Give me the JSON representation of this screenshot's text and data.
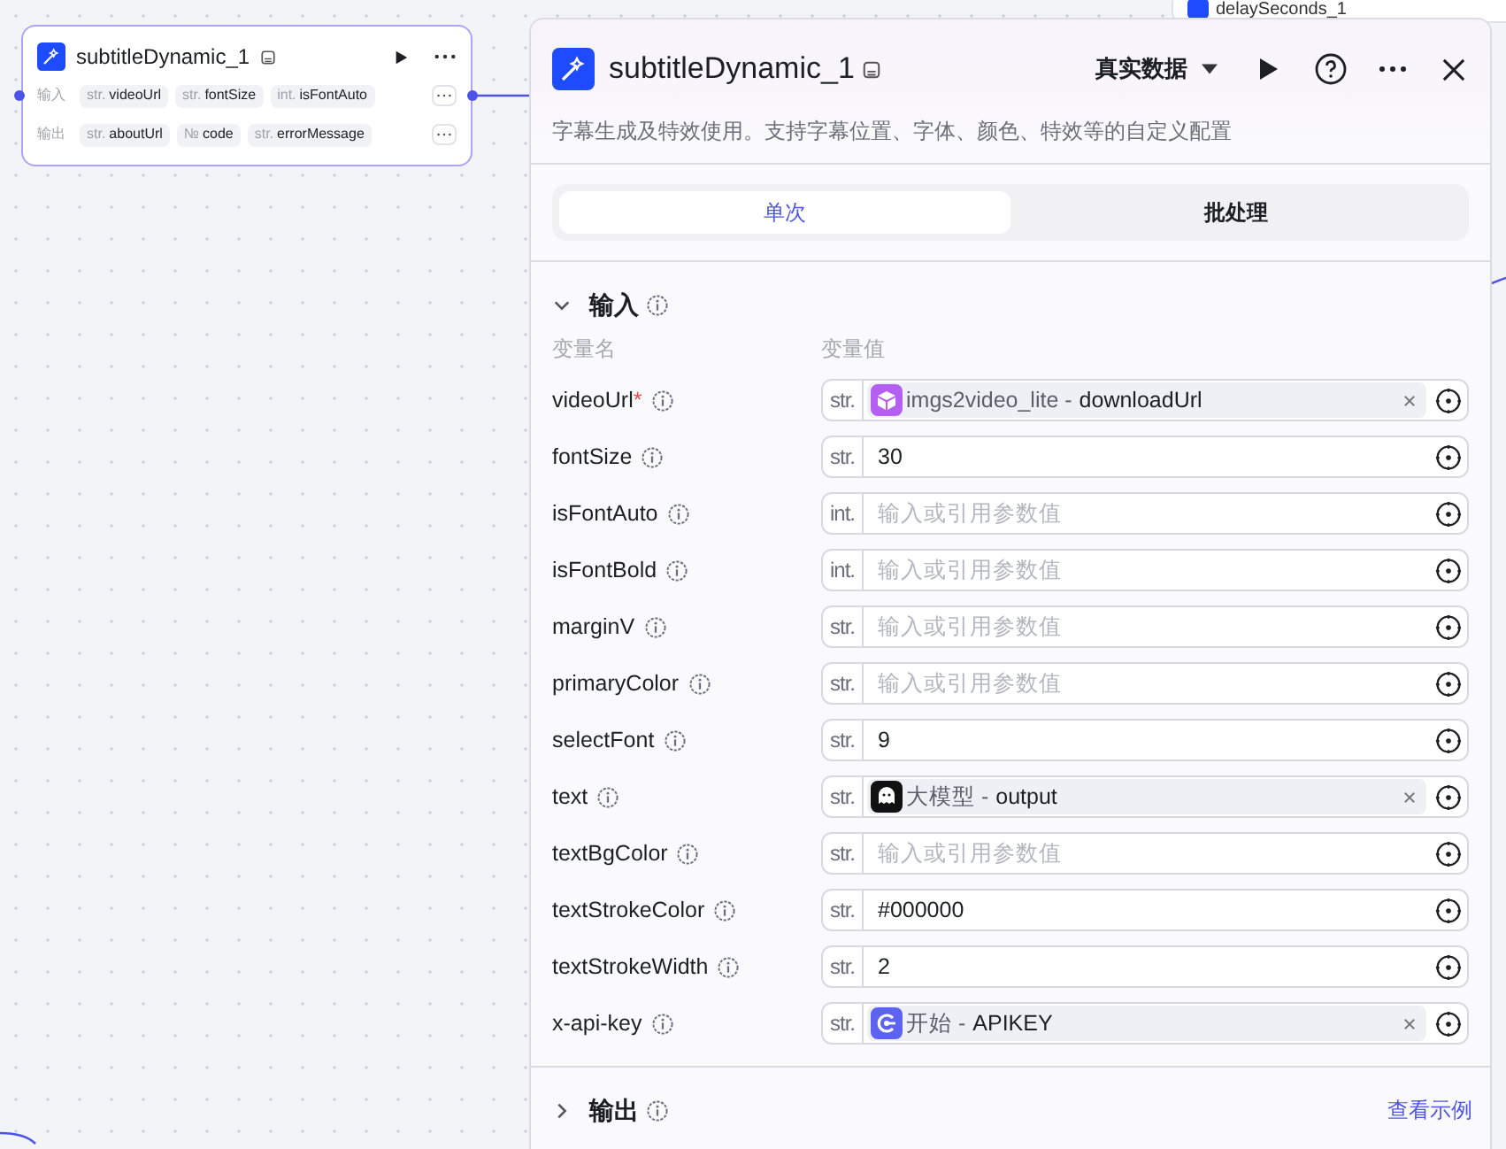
{
  "canvas": {
    "background_node": {
      "title": "delaySeconds_1"
    },
    "node": {
      "title": "subtitleDynamic_1",
      "input_label": "输入",
      "output_label": "输出",
      "inputs": [
        {
          "type": "str.",
          "name": "videoUrl"
        },
        {
          "type": "str.",
          "name": "fontSize"
        },
        {
          "type": "int.",
          "name": "isFontAuto"
        }
      ],
      "outputs": [
        {
          "type": "str.",
          "name": "aboutUrl"
        },
        {
          "type": "№",
          "name": "code"
        },
        {
          "type": "str.",
          "name": "errorMessage"
        }
      ]
    }
  },
  "panel": {
    "title": "subtitleDynamic_1",
    "data_mode": "真实数据",
    "description": "字幕生成及特效使用。支持字幕位置、字体、颜色、特效等的自定义配置",
    "tabs": [
      {
        "label": "单次",
        "selected": true
      },
      {
        "label": "批处理",
        "selected": false
      }
    ],
    "input_section": {
      "title": "输入",
      "expanded": true,
      "column_1": "变量名",
      "column_2": "变量值",
      "required_mark": "*",
      "rows": [
        {
          "name": "videoUrl",
          "required": true,
          "type": "str.",
          "kind": "reference",
          "color": "#b55ff2",
          "source": "imgs2video_lite -",
          "field": "downloadUrl"
        },
        {
          "name": "fontSize",
          "required": false,
          "type": "str.",
          "kind": "value",
          "value": "30"
        },
        {
          "name": "isFontAuto",
          "required": false,
          "type": "int.",
          "kind": "empty",
          "placeholder": "输入或引用参数值"
        },
        {
          "name": "isFontBold",
          "required": false,
          "type": "int.",
          "kind": "empty",
          "placeholder": "输入或引用参数值"
        },
        {
          "name": "marginV",
          "required": false,
          "type": "str.",
          "kind": "empty",
          "placeholder": "输入或引用参数值"
        },
        {
          "name": "primaryColor",
          "required": false,
          "type": "str.",
          "kind": "empty",
          "placeholder": "输入或引用参数值"
        },
        {
          "name": "selectFont",
          "required": false,
          "type": "str.",
          "kind": "value",
          "value": "9"
        },
        {
          "name": "text",
          "required": false,
          "type": "str.",
          "kind": "reference",
          "color": "#111111",
          "source": "大模型 -",
          "field": "output"
        },
        {
          "name": "textBgColor",
          "required": false,
          "type": "str.",
          "kind": "empty",
          "placeholder": "输入或引用参数值"
        },
        {
          "name": "textStrokeColor",
          "required": false,
          "type": "str.",
          "kind": "value",
          "value": "#000000"
        },
        {
          "name": "textStrokeWidth",
          "required": false,
          "type": "str.",
          "kind": "value",
          "value": "2"
        },
        {
          "name": "x-api-key",
          "required": false,
          "type": "str.",
          "kind": "reference",
          "color": "#5b63f0",
          "source": "开始 -",
          "field": "APIKEY"
        }
      ]
    },
    "output_section": {
      "title": "输出",
      "expanded": false,
      "link": "查看示例"
    }
  }
}
